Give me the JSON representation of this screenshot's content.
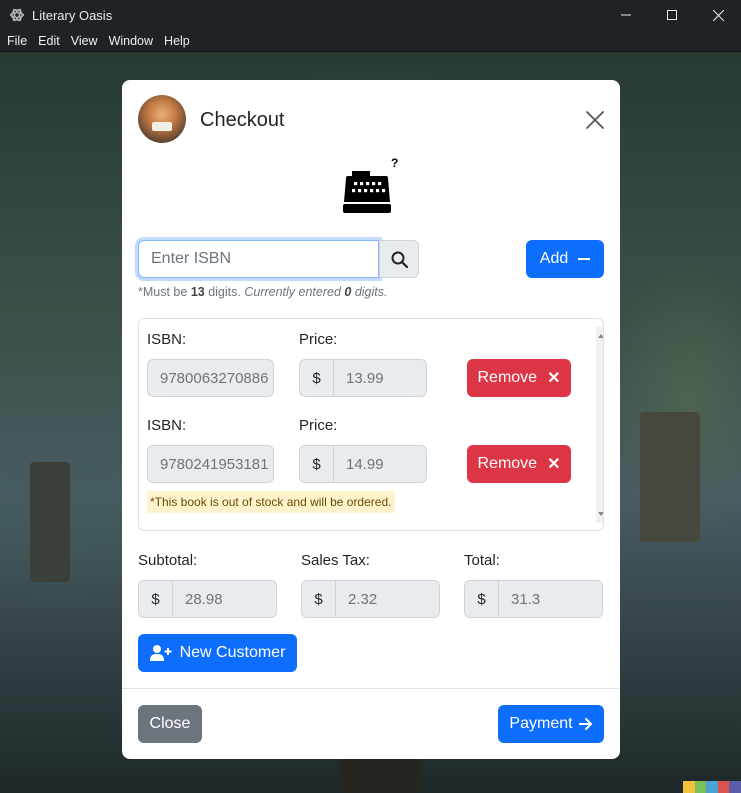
{
  "window": {
    "title": "Literary Oasis",
    "controls": [
      "minimize-icon",
      "maximize-icon",
      "close-icon"
    ]
  },
  "menu": [
    "File",
    "Edit",
    "View",
    "Window",
    "Help"
  ],
  "modal": {
    "title": "Checkout",
    "header_icon": "cash-register-icon",
    "register_badge": "?",
    "isbn_input": {
      "placeholder": "Enter ISBN",
      "value": ""
    },
    "add_label": "Add",
    "help": {
      "prefix": "*Must be ",
      "digits_required": "13",
      "mid": " digits. ",
      "current_prefix": "Currently entered ",
      "digits_entered": "0",
      "current_suffix": " digits."
    },
    "cart": [
      {
        "isbn_label": "ISBN:",
        "isbn": "9780063270886",
        "price_label": "Price:",
        "currency": "$",
        "price": "13.99",
        "remove_label": "Remove",
        "note": ""
      },
      {
        "isbn_label": "ISBN:",
        "isbn": "9780241953181",
        "price_label": "Price:",
        "currency": "$",
        "price": "14.99",
        "remove_label": "Remove",
        "note": "*This book is out of stock and will be ordered."
      }
    ],
    "totals": {
      "subtotal_label": "Subtotal:",
      "subtotal": "28.98",
      "tax_label": "Sales Tax:",
      "tax": "2.32",
      "total_label": "Total:",
      "total": "31.3",
      "currency": "$"
    },
    "new_customer_label": "New Customer",
    "close_label": "Close",
    "payment_label": "Payment"
  },
  "colors": {
    "primary": "#0d6efd",
    "danger": "#dc3545",
    "secondary": "#6c757d",
    "warning_bg": "#fff3cd",
    "titlebar": "#1f2326"
  }
}
